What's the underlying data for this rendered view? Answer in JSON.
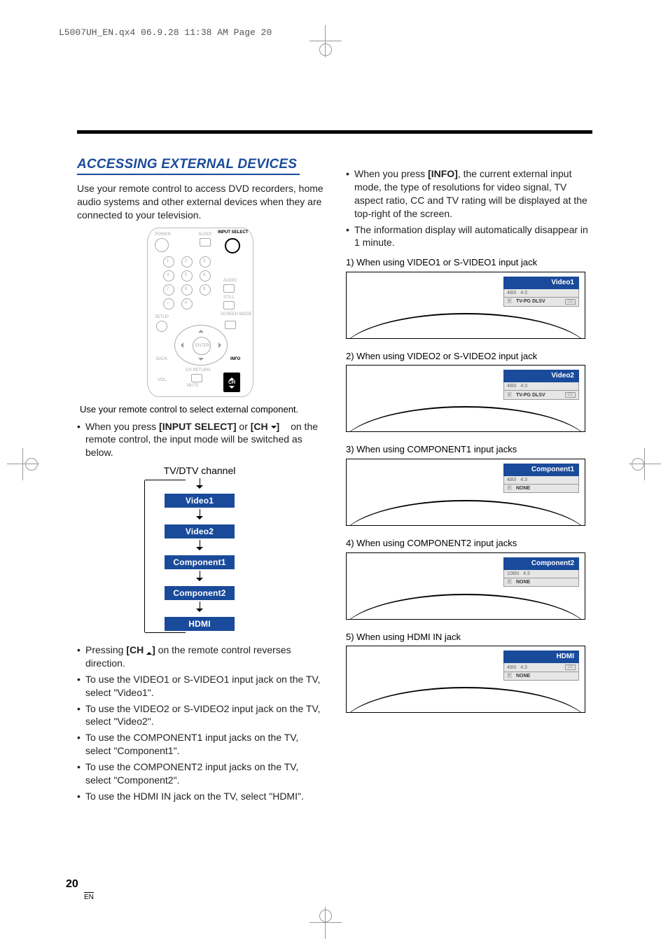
{
  "print": {
    "header": "L5007UH_EN.qx4  06.9.28  11:38 AM  Page 20"
  },
  "page": {
    "number": "20",
    "lang": "EN"
  },
  "title": "ACCESSING EXTERNAL DEVICES",
  "intro": "Use your remote control to access DVD recorders, home audio systems and other external devices when they are connected to your television.",
  "remote": {
    "label": "Use your remote control to select external component.",
    "power": "POWER",
    "sleep": "SLEEP",
    "input_select": "INPUT SELECT",
    "audio": "AUDIO",
    "still": "STILL",
    "setup": "SETUP",
    "screen_mode": "SCREEN MODE",
    "enter": "ENTER",
    "back": "BACK",
    "info": "INFO",
    "ch_return": "CH RETURN",
    "vol": "VOL.",
    "mute": "MUTE",
    "ch": "CH"
  },
  "left_bullets": {
    "b1_a": "When you press ",
    "b1_b": " or ",
    "b1_c": " on the remote control, the input mode will be switched as below.",
    "b1_btn1": "[INPUT SELECT]",
    "b1_btn2": "[CH ▼]",
    "b2_a": "Pressing ",
    "b2_btn": "[CH ▲]",
    "b2_b": " on the remote control reverses direction.",
    "b3": "To use the VIDEO1 or S-VIDEO1 input jack on the TV, select \"Video1\".",
    "b4": "To use the VIDEO2 or S-VIDEO2 input jack on the TV, select \"Video2\".",
    "b5": "To use the COMPONENT1 input jacks on the TV, select \"Component1\".",
    "b6": "To use the COMPONENT2 input jacks on the TV, select \"Component2\".",
    "b7": "To use the HDMI IN jack on the TV, select \"HDMI\"."
  },
  "flow": {
    "head": "TV/DTV channel",
    "v1": "Video1",
    "v2": "Video2",
    "c1": "Component1",
    "c2": "Component2",
    "h": "HDMI"
  },
  "right_bullets": {
    "b1_a": "When you press ",
    "b1_btn": "[INFO]",
    "b1_b": ", the current external input mode, the type of resolutions for video signal, TV aspect ratio, CC and TV rating will be displayed at the top-right of the screen.",
    "b2": "The information display will automatically disappear in 1 minute."
  },
  "screens": {
    "s1": {
      "cap": "1) When using VIDEO1 or S-VIDEO1 input jack",
      "title": "Video1",
      "line1a": "480i",
      "line1b": "4:3",
      "line2": "TV-PG DLSV"
    },
    "s2": {
      "cap": "2) When using VIDEO2 or S-VIDEO2 input jack",
      "title": "Video2",
      "line1a": "480i",
      "line1b": "4:3",
      "line2": "TV-PG DLSV"
    },
    "s3": {
      "cap": "3) When using COMPONENT1 input jacks",
      "title": "Component1",
      "line1a": "480i",
      "line1b": "4:3",
      "line2": "NONE"
    },
    "s4": {
      "cap": "4) When using COMPONENT2 input jacks",
      "title": "Component2",
      "line1a": "1080i",
      "line1b": "4:3",
      "line2": "NONE"
    },
    "s5": {
      "cap": "5) When using HDMI IN jack",
      "title": "HDMI",
      "line1a": "480i",
      "line1b": "4:3",
      "line2": "NONE"
    }
  },
  "osd_common": {
    "cc": "CC",
    "rating_icon": "🅁"
  }
}
